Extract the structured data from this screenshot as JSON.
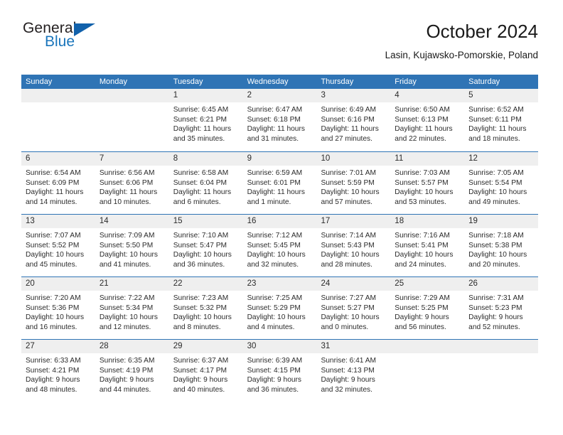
{
  "brand": {
    "name_part1": "General",
    "name_part2": "Blue",
    "logo_icon": "triangle-flag-icon"
  },
  "header": {
    "title": "October 2024",
    "subtitle": "Lasin, Kujawsko-Pomorskie, Poland"
  },
  "colors": {
    "header_blue": "#2F74B5",
    "brand_blue": "#1A75BB",
    "day_band_gray": "#EFEFEF",
    "text": "#2B2B2B"
  },
  "weekdays": [
    "Sunday",
    "Monday",
    "Tuesday",
    "Wednesday",
    "Thursday",
    "Friday",
    "Saturday"
  ],
  "weeks": [
    [
      {
        "num": "",
        "sunrise": "",
        "sunset": "",
        "daylight1": "",
        "daylight2": "",
        "empty": true
      },
      {
        "num": "",
        "sunrise": "",
        "sunset": "",
        "daylight1": "",
        "daylight2": "",
        "empty": true
      },
      {
        "num": "1",
        "sunrise": "Sunrise: 6:45 AM",
        "sunset": "Sunset: 6:21 PM",
        "daylight1": "Daylight: 11 hours",
        "daylight2": "and 35 minutes."
      },
      {
        "num": "2",
        "sunrise": "Sunrise: 6:47 AM",
        "sunset": "Sunset: 6:18 PM",
        "daylight1": "Daylight: 11 hours",
        "daylight2": "and 31 minutes."
      },
      {
        "num": "3",
        "sunrise": "Sunrise: 6:49 AM",
        "sunset": "Sunset: 6:16 PM",
        "daylight1": "Daylight: 11 hours",
        "daylight2": "and 27 minutes."
      },
      {
        "num": "4",
        "sunrise": "Sunrise: 6:50 AM",
        "sunset": "Sunset: 6:13 PM",
        "daylight1": "Daylight: 11 hours",
        "daylight2": "and 22 minutes."
      },
      {
        "num": "5",
        "sunrise": "Sunrise: 6:52 AM",
        "sunset": "Sunset: 6:11 PM",
        "daylight1": "Daylight: 11 hours",
        "daylight2": "and 18 minutes."
      }
    ],
    [
      {
        "num": "6",
        "sunrise": "Sunrise: 6:54 AM",
        "sunset": "Sunset: 6:09 PM",
        "daylight1": "Daylight: 11 hours",
        "daylight2": "and 14 minutes."
      },
      {
        "num": "7",
        "sunrise": "Sunrise: 6:56 AM",
        "sunset": "Sunset: 6:06 PM",
        "daylight1": "Daylight: 11 hours",
        "daylight2": "and 10 minutes."
      },
      {
        "num": "8",
        "sunrise": "Sunrise: 6:58 AM",
        "sunset": "Sunset: 6:04 PM",
        "daylight1": "Daylight: 11 hours",
        "daylight2": "and 6 minutes."
      },
      {
        "num": "9",
        "sunrise": "Sunrise: 6:59 AM",
        "sunset": "Sunset: 6:01 PM",
        "daylight1": "Daylight: 11 hours",
        "daylight2": "and 1 minute."
      },
      {
        "num": "10",
        "sunrise": "Sunrise: 7:01 AM",
        "sunset": "Sunset: 5:59 PM",
        "daylight1": "Daylight: 10 hours",
        "daylight2": "and 57 minutes."
      },
      {
        "num": "11",
        "sunrise": "Sunrise: 7:03 AM",
        "sunset": "Sunset: 5:57 PM",
        "daylight1": "Daylight: 10 hours",
        "daylight2": "and 53 minutes."
      },
      {
        "num": "12",
        "sunrise": "Sunrise: 7:05 AM",
        "sunset": "Sunset: 5:54 PM",
        "daylight1": "Daylight: 10 hours",
        "daylight2": "and 49 minutes."
      }
    ],
    [
      {
        "num": "13",
        "sunrise": "Sunrise: 7:07 AM",
        "sunset": "Sunset: 5:52 PM",
        "daylight1": "Daylight: 10 hours",
        "daylight2": "and 45 minutes."
      },
      {
        "num": "14",
        "sunrise": "Sunrise: 7:09 AM",
        "sunset": "Sunset: 5:50 PM",
        "daylight1": "Daylight: 10 hours",
        "daylight2": "and 41 minutes."
      },
      {
        "num": "15",
        "sunrise": "Sunrise: 7:10 AM",
        "sunset": "Sunset: 5:47 PM",
        "daylight1": "Daylight: 10 hours",
        "daylight2": "and 36 minutes."
      },
      {
        "num": "16",
        "sunrise": "Sunrise: 7:12 AM",
        "sunset": "Sunset: 5:45 PM",
        "daylight1": "Daylight: 10 hours",
        "daylight2": "and 32 minutes."
      },
      {
        "num": "17",
        "sunrise": "Sunrise: 7:14 AM",
        "sunset": "Sunset: 5:43 PM",
        "daylight1": "Daylight: 10 hours",
        "daylight2": "and 28 minutes."
      },
      {
        "num": "18",
        "sunrise": "Sunrise: 7:16 AM",
        "sunset": "Sunset: 5:41 PM",
        "daylight1": "Daylight: 10 hours",
        "daylight2": "and 24 minutes."
      },
      {
        "num": "19",
        "sunrise": "Sunrise: 7:18 AM",
        "sunset": "Sunset: 5:38 PM",
        "daylight1": "Daylight: 10 hours",
        "daylight2": "and 20 minutes."
      }
    ],
    [
      {
        "num": "20",
        "sunrise": "Sunrise: 7:20 AM",
        "sunset": "Sunset: 5:36 PM",
        "daylight1": "Daylight: 10 hours",
        "daylight2": "and 16 minutes."
      },
      {
        "num": "21",
        "sunrise": "Sunrise: 7:22 AM",
        "sunset": "Sunset: 5:34 PM",
        "daylight1": "Daylight: 10 hours",
        "daylight2": "and 12 minutes."
      },
      {
        "num": "22",
        "sunrise": "Sunrise: 7:23 AM",
        "sunset": "Sunset: 5:32 PM",
        "daylight1": "Daylight: 10 hours",
        "daylight2": "and 8 minutes."
      },
      {
        "num": "23",
        "sunrise": "Sunrise: 7:25 AM",
        "sunset": "Sunset: 5:29 PM",
        "daylight1": "Daylight: 10 hours",
        "daylight2": "and 4 minutes."
      },
      {
        "num": "24",
        "sunrise": "Sunrise: 7:27 AM",
        "sunset": "Sunset: 5:27 PM",
        "daylight1": "Daylight: 10 hours",
        "daylight2": "and 0 minutes."
      },
      {
        "num": "25",
        "sunrise": "Sunrise: 7:29 AM",
        "sunset": "Sunset: 5:25 PM",
        "daylight1": "Daylight: 9 hours",
        "daylight2": "and 56 minutes."
      },
      {
        "num": "26",
        "sunrise": "Sunrise: 7:31 AM",
        "sunset": "Sunset: 5:23 PM",
        "daylight1": "Daylight: 9 hours",
        "daylight2": "and 52 minutes."
      }
    ],
    [
      {
        "num": "27",
        "sunrise": "Sunrise: 6:33 AM",
        "sunset": "Sunset: 4:21 PM",
        "daylight1": "Daylight: 9 hours",
        "daylight2": "and 48 minutes."
      },
      {
        "num": "28",
        "sunrise": "Sunrise: 6:35 AM",
        "sunset": "Sunset: 4:19 PM",
        "daylight1": "Daylight: 9 hours",
        "daylight2": "and 44 minutes."
      },
      {
        "num": "29",
        "sunrise": "Sunrise: 6:37 AM",
        "sunset": "Sunset: 4:17 PM",
        "daylight1": "Daylight: 9 hours",
        "daylight2": "and 40 minutes."
      },
      {
        "num": "30",
        "sunrise": "Sunrise: 6:39 AM",
        "sunset": "Sunset: 4:15 PM",
        "daylight1": "Daylight: 9 hours",
        "daylight2": "and 36 minutes."
      },
      {
        "num": "31",
        "sunrise": "Sunrise: 6:41 AM",
        "sunset": "Sunset: 4:13 PM",
        "daylight1": "Daylight: 9 hours",
        "daylight2": "and 32 minutes."
      },
      {
        "num": "",
        "sunrise": "",
        "sunset": "",
        "daylight1": "",
        "daylight2": "",
        "empty": true
      },
      {
        "num": "",
        "sunrise": "",
        "sunset": "",
        "daylight1": "",
        "daylight2": "",
        "empty": true
      }
    ]
  ]
}
